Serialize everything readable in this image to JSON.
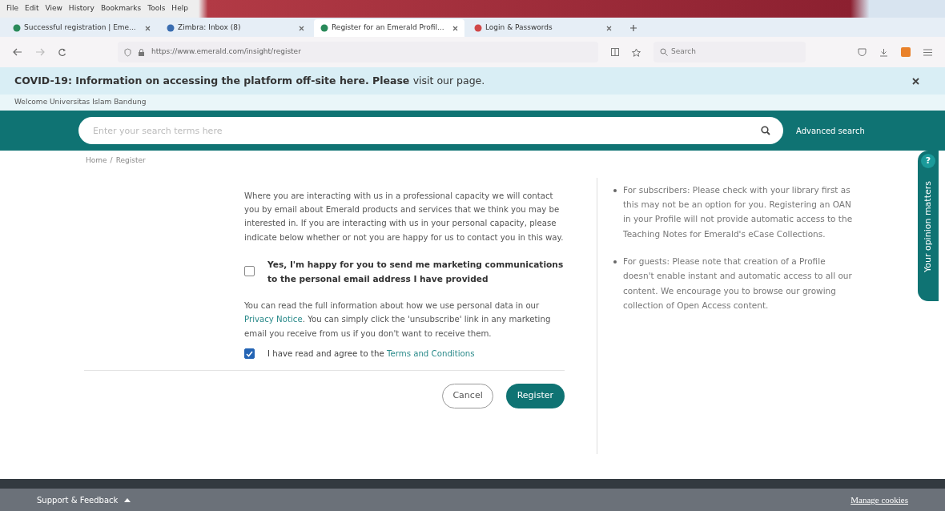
{
  "browser": {
    "menu": [
      "File",
      "Edit",
      "View",
      "History",
      "Bookmarks",
      "Tools",
      "Help"
    ],
    "tabs": [
      {
        "label": "Successful registration | Eme...",
        "selected": false
      },
      {
        "label": "Zimbra: Inbox (8)",
        "selected": false
      },
      {
        "label": "Register for an Emerald Profil...",
        "selected": true
      },
      {
        "label": "Login & Passwords",
        "selected": false
      }
    ],
    "address": "https://www.emerald.com/insight/register",
    "search_placeholder": "Search"
  },
  "banner": {
    "text": "COVID-19: Information on accessing the platform off-site here. Please",
    "link": "visit our page."
  },
  "welcome": "Welcome Universitas Islam Bandung",
  "search": {
    "placeholder": "Enter your search terms here",
    "advanced": "Advanced search"
  },
  "breadcrumb": {
    "items": [
      "Home",
      "Register"
    ],
    "separator": "/"
  },
  "form": {
    "intro": "Where you are interacting with us in a professional capacity we will contact you by email about Emerald products and services that we think you may be interested in. If you are interacting with us in your personal capacity, please indicate below whether or not you are happy for us to contact you in this way.",
    "marketing": {
      "label": "Yes, I'm happy for you to send me marketing communications to the personal email address I have provided",
      "checked": false
    },
    "privacy": {
      "before": "You can read the full information about how we use personal data in our",
      "link": "Privacy Notice",
      "after": ". You can simply click the 'unsubscribe' link in any marketing email you receive from us if you don't want to receive them."
    },
    "terms": {
      "label": "I have read and agree to the",
      "link": "Terms and Conditions",
      "checked": true
    },
    "cancel": "Cancel",
    "register": "Register"
  },
  "notes": [
    "For subscribers: Please check with your library first as this may not be an option for you. Registering an OAN in your Profile will not provide automatic access to the Teaching Notes for Emerald's eCase Collections.",
    "For guests: Please note that creation of a Profile doesn't enable instant and automatic access to all our content. We encourage you to browse our growing collection of Open Access content."
  ],
  "feedback": {
    "label": "Your opinion matters",
    "icon_text": "?"
  },
  "footer": {
    "support": "Support & Feedback",
    "cookies": "Manage cookies"
  }
}
